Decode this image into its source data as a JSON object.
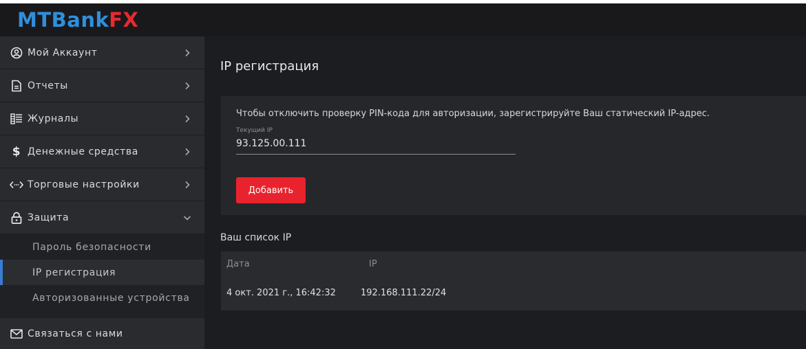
{
  "brand": {
    "logo_part1": "MTBank",
    "logo_part2": "FX",
    "colors": {
      "blue": "#2f8fdc",
      "red": "#e52b2f"
    }
  },
  "sidebar": {
    "items": [
      {
        "label": "Мой Аккаунт",
        "icon": "user-circle-icon",
        "expanded": false
      },
      {
        "label": "Отчеты",
        "icon": "document-icon",
        "expanded": false
      },
      {
        "label": "Журналы",
        "icon": "journal-list-icon",
        "expanded": false
      },
      {
        "label": "Денежные средства",
        "icon": "dollar-icon",
        "expanded": false
      },
      {
        "label": "Торговые настройки",
        "icon": "code-arrows-icon",
        "expanded": false
      },
      {
        "label": "Защита",
        "icon": "lock-icon",
        "expanded": true
      }
    ],
    "subitems": [
      {
        "label": "Пароль безопасности",
        "active": false
      },
      {
        "label": "IP регистрация",
        "active": true
      },
      {
        "label": "Авторизованные устройства",
        "active": false
      }
    ],
    "contact": {
      "label": "Связаться с нами",
      "icon": "mail-icon"
    }
  },
  "main": {
    "title": "IP регистрация",
    "card": {
      "description": "Чтобы отключить проверку PIN-кода для авторизации, зарегистрируйте Ваш статический IP-адрес.",
      "field_label": "Текущий IP",
      "field_value": "93.125.00.111",
      "button_label": "Добавить",
      "button_color": "#e8232e"
    },
    "list_title": "Ваш список IP",
    "table": {
      "headers": [
        "Дата",
        "IP"
      ],
      "rows": [
        [
          "4 окт. 2021 г., 16:42:32",
          "192.168.111.22/24"
        ]
      ]
    }
  }
}
